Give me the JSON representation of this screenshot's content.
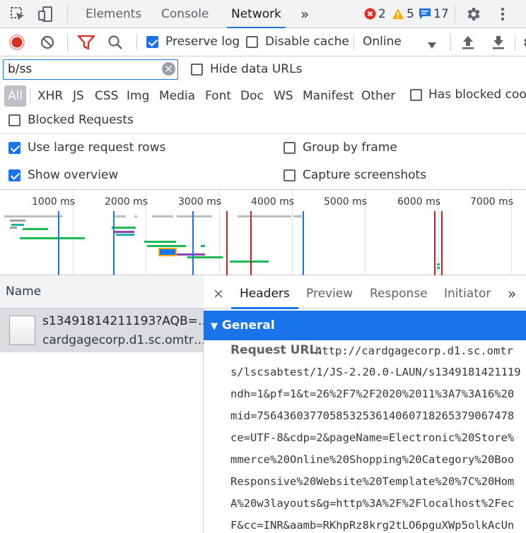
{
  "topbar": {
    "tabs": [
      "Elements",
      "Console",
      "Network"
    ],
    "active_tab": "Network",
    "more_tabs": "»",
    "errors": "2",
    "warnings": "5",
    "messages": "17"
  },
  "toolbar": {
    "preserve_log": "Preserve log",
    "disable_cache": "Disable cache",
    "throttling": "Online"
  },
  "filter": {
    "value": "b/ss",
    "clear": "×",
    "hide_data_urls": "Hide data URLs"
  },
  "type_filters": [
    "All",
    "XHR",
    "JS",
    "CSS",
    "Img",
    "Media",
    "Font",
    "Doc",
    "WS",
    "Manifest",
    "Other"
  ],
  "has_blocked": "Has blocked cook",
  "blocked_requests": "Blocked Requests",
  "settings": {
    "large_rows": "Use large request rows",
    "group_by_frame": "Group by frame",
    "show_overview": "Show overview",
    "capture_screenshots": "Capture screenshots"
  },
  "overview": {
    "ticks": [
      "1000 ms",
      "2000 ms",
      "3000 ms",
      "4000 ms",
      "5000 ms",
      "6000 ms",
      "7000 ms"
    ]
  },
  "list": {
    "name_header": "Name",
    "request_name": "s13491814211193?AQB=…",
    "request_domain": "cardgagecorp.d1.sc.omtr…"
  },
  "details": {
    "close": "×",
    "tabs": [
      "Headers",
      "Preview",
      "Response",
      "Initiator"
    ],
    "more": "»",
    "section": "General",
    "request_url_label": "Request URL:",
    "url_lines": [
      "http://cardgagecorp.d1.sc.omtr",
      "s/lscsabtest/1/JS-2.20.0-LAUN/s1349181421119",
      "ndh=1&pf=1&t=26%2F7%2F2020%2011%3A7%3A16%20",
      "mid=756436037705853253614060718265379067478",
      "ce=UTF-8&cdp=2&pageName=Electronic%20Store%",
      "mmerce%20Online%20Shopping%20Category%20Boo",
      "Responsive%20Website%20Template%20%7C%20Hom",
      "A%20w3layouts&g=http%3A%2F%2Flocalhost%2Fec",
      "F&cc=INR&aamb=RKhpRz8krg2tLO6pguXWp5olkAcUn"
    ]
  },
  "colors": {
    "accent": "#1a73e8",
    "record": "#d93025",
    "filter_icon": "#d93025",
    "error": "#d93025",
    "warning": "#f9ab00"
  }
}
